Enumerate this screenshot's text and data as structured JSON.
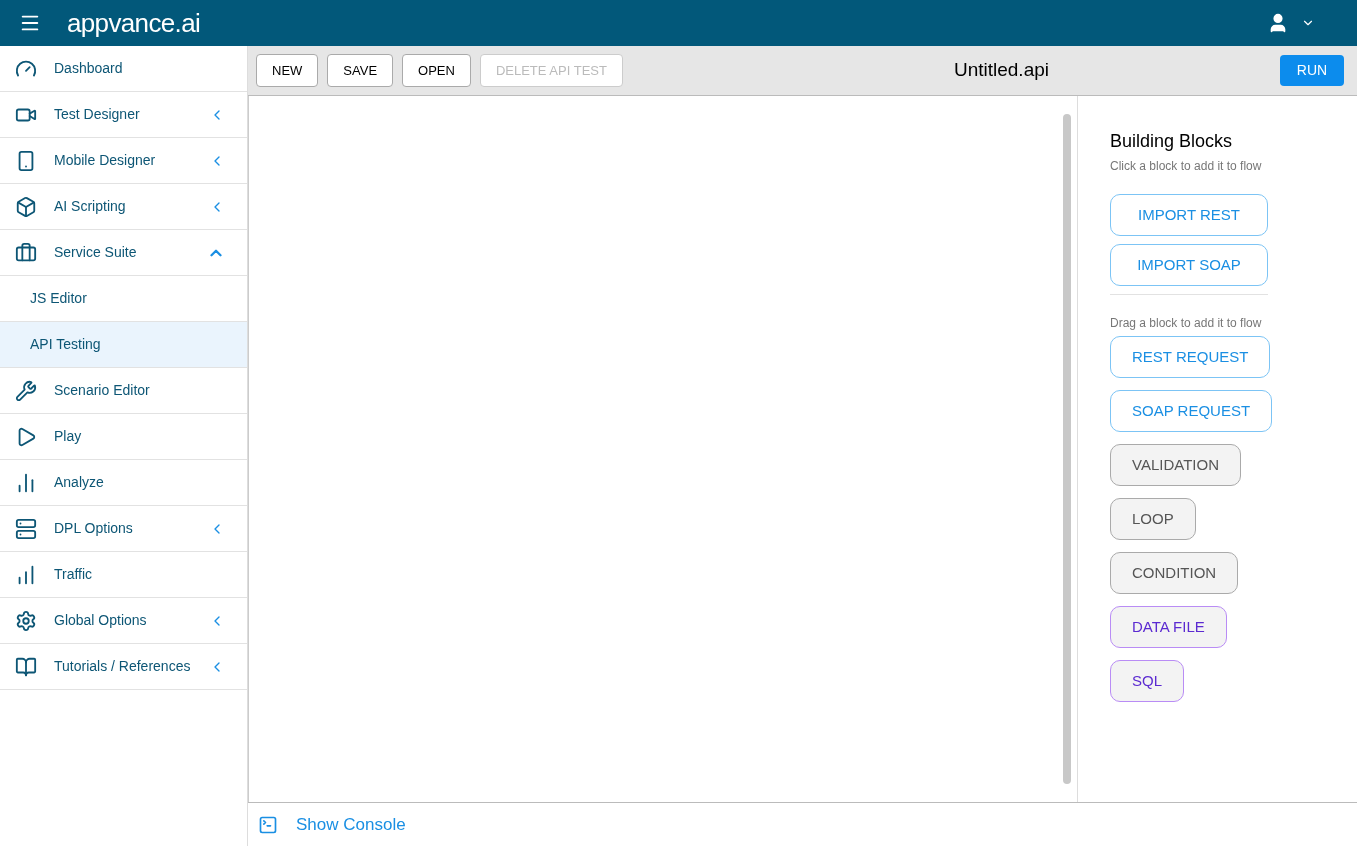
{
  "header": {
    "logo": "appvance.ai"
  },
  "sidebar": {
    "items": [
      {
        "label": "Dashboard",
        "kind": "link",
        "selected": false
      },
      {
        "label": "Test Designer",
        "kind": "group",
        "expanded": false,
        "selected": false
      },
      {
        "label": "Mobile Designer",
        "kind": "group",
        "expanded": false,
        "selected": false
      },
      {
        "label": "AI Scripting",
        "kind": "group",
        "expanded": false,
        "selected": false
      },
      {
        "label": "Service Suite",
        "kind": "group",
        "expanded": true,
        "selected": false
      },
      {
        "label": "JS Editor",
        "kind": "subitem",
        "selected": false
      },
      {
        "label": "API Testing",
        "kind": "subitem",
        "selected": true
      },
      {
        "label": "Scenario Editor",
        "kind": "link",
        "selected": false
      },
      {
        "label": "Play",
        "kind": "link",
        "selected": false
      },
      {
        "label": "Analyze",
        "kind": "link",
        "selected": false
      },
      {
        "label": "DPL Options",
        "kind": "group",
        "expanded": false,
        "selected": false
      },
      {
        "label": "Traffic",
        "kind": "link",
        "selected": false
      },
      {
        "label": "Global Options",
        "kind": "group",
        "expanded": false,
        "selected": false
      },
      {
        "label": "Tutorials / References",
        "kind": "group",
        "expanded": false,
        "selected": false
      }
    ]
  },
  "toolbar": {
    "buttons": [
      {
        "label": "NEW",
        "disabled": false
      },
      {
        "label": "SAVE",
        "disabled": false
      },
      {
        "label": "OPEN",
        "disabled": false
      },
      {
        "label": "DELETE API TEST",
        "disabled": true
      }
    ],
    "file_name": "Untitled.api",
    "run_button": "RUN"
  },
  "building_blocks": {
    "title": "Building Blocks",
    "click_hint": "Click a block to add it to flow",
    "click_blocks": [
      {
        "label": "IMPORT REST",
        "kind": "import"
      },
      {
        "label": "IMPORT SOAP",
        "kind": "import"
      }
    ],
    "drag_hint": "Drag a block to add it to flow",
    "drag_blocks": [
      {
        "label": "REST REQUEST",
        "kind": "request"
      },
      {
        "label": "SOAP REQUEST",
        "kind": "request"
      },
      {
        "label": "VALIDATION",
        "kind": "control"
      },
      {
        "label": "LOOP",
        "kind": "control"
      },
      {
        "label": "CONDITION",
        "kind": "control"
      },
      {
        "label": "DATA FILE",
        "kind": "data"
      },
      {
        "label": "SQL",
        "kind": "data"
      }
    ]
  },
  "console": {
    "label": "Show Console"
  }
}
